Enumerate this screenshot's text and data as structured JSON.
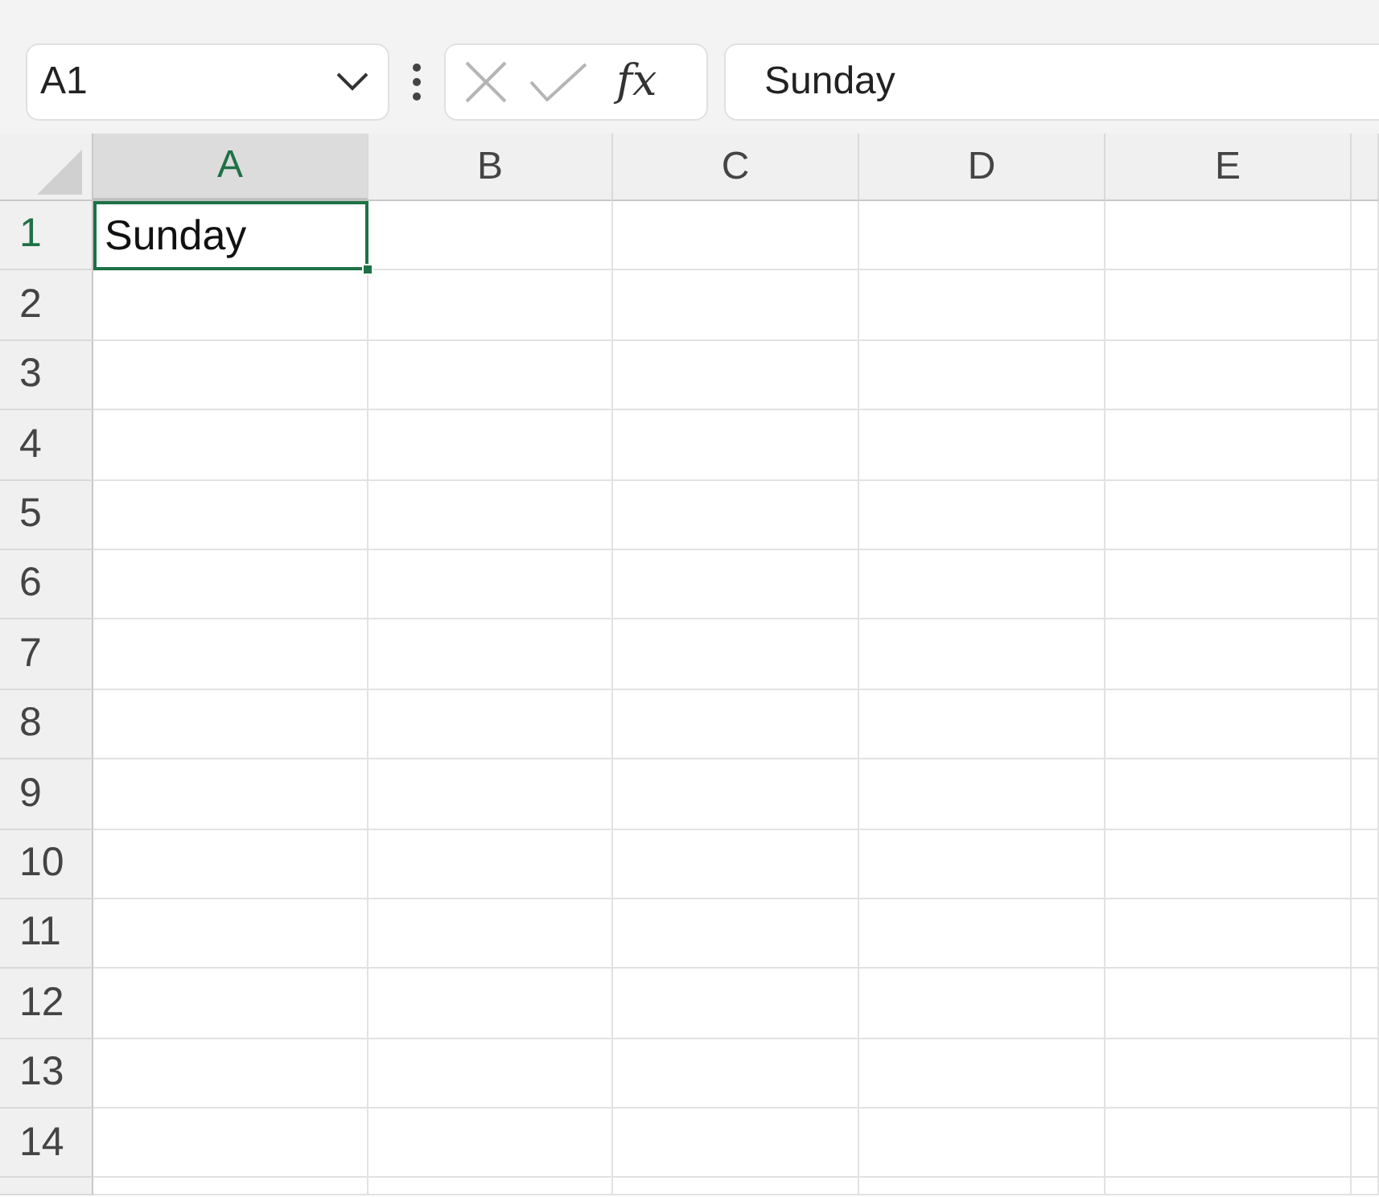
{
  "name_box": {
    "value": "A1"
  },
  "formula_bar": {
    "function_label": "fx",
    "value": "Sunday"
  },
  "columns": [
    {
      "label": "A",
      "selected": true
    },
    {
      "label": "B",
      "selected": false
    },
    {
      "label": "C",
      "selected": false
    },
    {
      "label": "D",
      "selected": false
    },
    {
      "label": "E",
      "selected": false
    }
  ],
  "rows": [
    {
      "label": "1",
      "selected": true
    },
    {
      "label": "2",
      "selected": false
    },
    {
      "label": "3",
      "selected": false
    },
    {
      "label": "4",
      "selected": false
    },
    {
      "label": "5",
      "selected": false
    },
    {
      "label": "6",
      "selected": false
    },
    {
      "label": "7",
      "selected": false
    },
    {
      "label": "8",
      "selected": false
    },
    {
      "label": "9",
      "selected": false
    },
    {
      "label": "10",
      "selected": false
    },
    {
      "label": "11",
      "selected": false
    },
    {
      "label": "12",
      "selected": false
    },
    {
      "label": "13",
      "selected": false
    },
    {
      "label": "14",
      "selected": false
    }
  ],
  "active_cell": {
    "value": "Sunday"
  }
}
